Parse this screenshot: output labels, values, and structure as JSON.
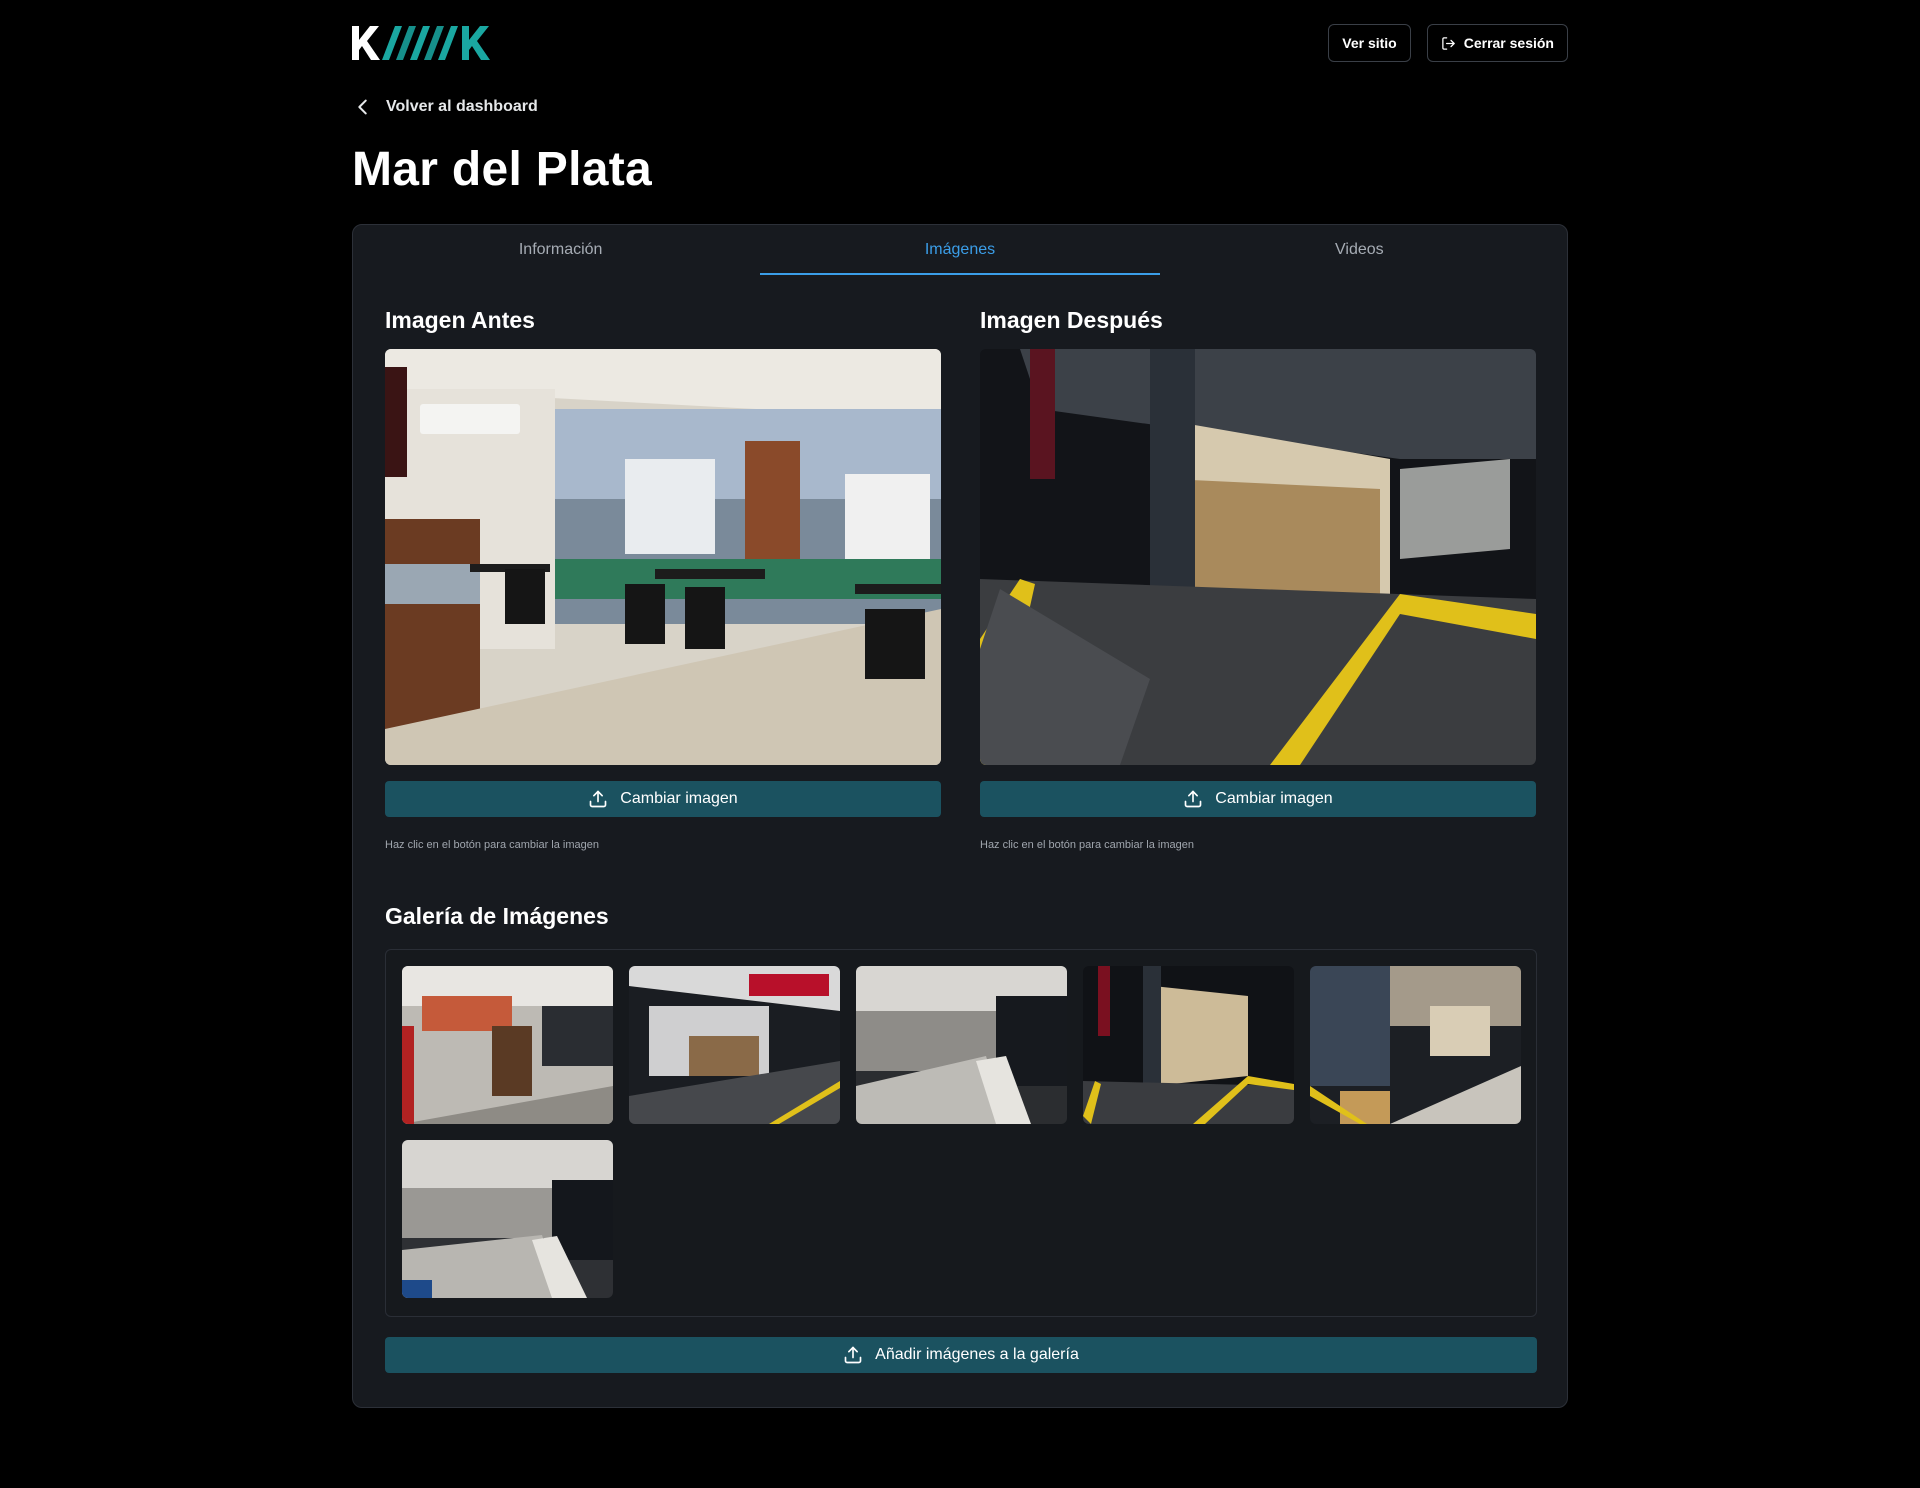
{
  "header": {
    "logo_text": "KAMAK",
    "view_site_label": "Ver sitio",
    "logout_label": "Cerrar sesión"
  },
  "back_label": "Volver al dashboard",
  "page_title": "Mar del Plata",
  "tabs": [
    {
      "label": "Información",
      "active": false
    },
    {
      "label": "Imágenes",
      "active": true
    },
    {
      "label": "Videos",
      "active": false
    }
  ],
  "before": {
    "title": "Imagen Antes",
    "button_label": "Cambiar imagen",
    "hint": "Haz clic en el botón para cambiar la imagen"
  },
  "after": {
    "title": "Imagen Después",
    "button_label": "Cambiar imagen",
    "hint": "Haz clic en el botón para cambiar la imagen"
  },
  "gallery": {
    "title": "Galería de Imágenes",
    "add_button_label": "Añadir imágenes a la galería",
    "image_count": 6
  },
  "colors": {
    "accent": "#3b9ee8",
    "button_bg": "#1b5260",
    "card_bg": "#171a1f",
    "logo_teal": "#1aa7a1"
  }
}
